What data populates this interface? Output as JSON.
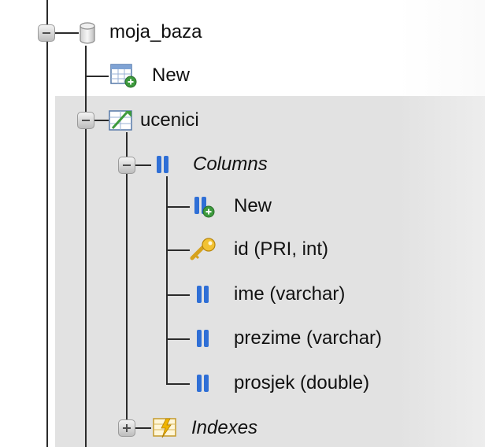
{
  "tree": {
    "database": {
      "label": "moja_baza",
      "icon": "database-icon"
    },
    "new_table": {
      "label": "New",
      "icon": "table-new-icon"
    },
    "table": {
      "label": "ucenici",
      "icon": "table-structure-icon"
    },
    "columns_group": {
      "label": "Columns",
      "icon": "columns-icon"
    },
    "columns": [
      {
        "label": "New",
        "icon": "column-new-icon"
      },
      {
        "label": "id (PRI, int)",
        "icon": "key-icon"
      },
      {
        "label": "ime (varchar)",
        "icon": "column-icon"
      },
      {
        "label": "prezime (varchar)",
        "icon": "column-icon"
      },
      {
        "label": "prosjek (double)",
        "icon": "column-icon"
      }
    ],
    "indexes_group": {
      "label": "Indexes",
      "icon": "indexes-icon"
    }
  },
  "colors": {
    "selected_background": "#e2e2e2",
    "tree_line": "#2b2b2b",
    "column_icon": "#2f6fd6"
  }
}
